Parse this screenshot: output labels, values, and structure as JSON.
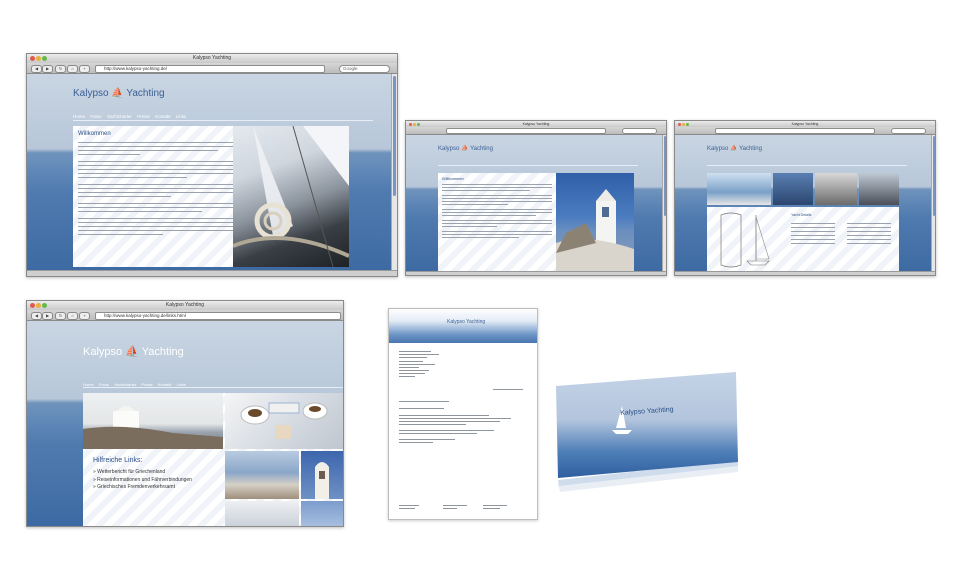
{
  "brand": {
    "name_part1": "Kalypso",
    "name_part2": "Yachting"
  },
  "window1": {
    "title": "Kalypso Yachting",
    "url": "http://www.kalypso-yachting.de/",
    "search_placeholder": "Google",
    "nav": [
      "Home",
      "Fotos",
      "Yachtcharter",
      "Preise",
      "Kontakt",
      "Links"
    ],
    "heading": "Willkommen"
  },
  "window2": {
    "title": "Kalypso Yachting",
    "heading": "Willkommen"
  },
  "window3": {
    "title": "Kalypso Yachting",
    "heading": "Yacht Details"
  },
  "window4": {
    "title": "Kalypso Yachting",
    "url": "http://www.kalypso-yachting.de/links.html",
    "nav": [
      "Home",
      "Fotos",
      "Yachtcharter",
      "Preise",
      "Kontakt",
      "Links"
    ],
    "heading": "Hilfreiche Links:",
    "links": [
      "» Wetterbericht für Griechenland",
      "» Reiseinformationen und Fährverbindungen",
      "» Griechisches Fremdenverkehrsamt"
    ]
  },
  "letter": {
    "logo_text": "Kalypso Yachting"
  },
  "card": {
    "logo_text": "Kalypso Yachting"
  },
  "icons": {
    "sail": "sailboat-icon",
    "back": "back-arrow-icon",
    "forward": "forward-arrow-icon",
    "reload": "reload-icon",
    "home": "home-icon"
  }
}
